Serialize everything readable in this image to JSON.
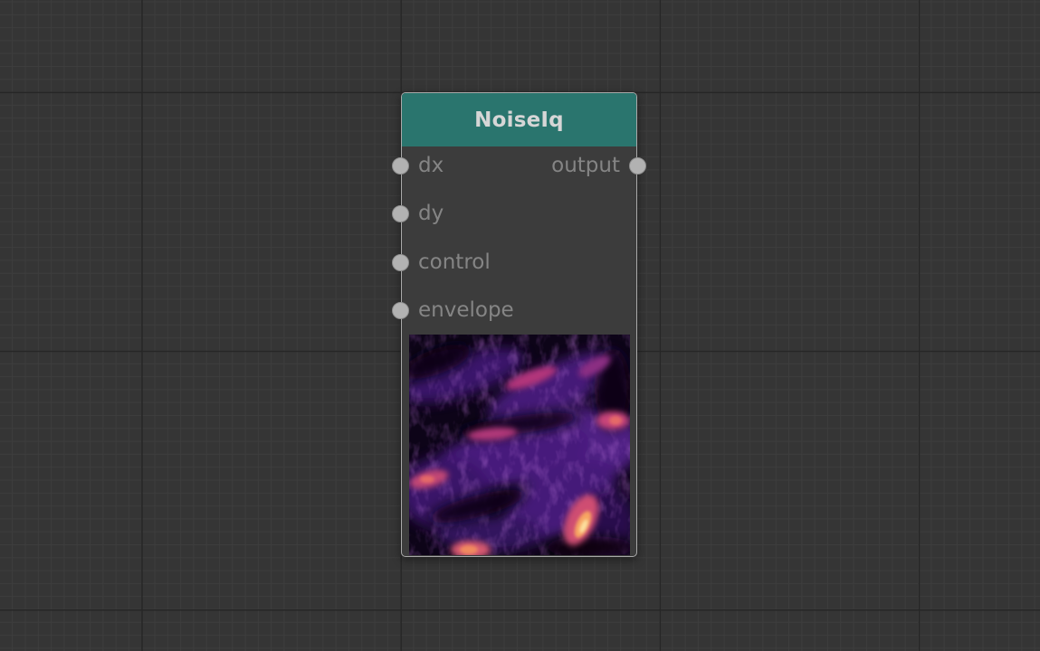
{
  "node": {
    "title": "NoiseIq",
    "header_color": "#2a756e",
    "inputs": [
      {
        "label": "dx"
      },
      {
        "label": "dy"
      },
      {
        "label": "control"
      },
      {
        "label": "envelope"
      }
    ],
    "outputs": [
      {
        "label": "output"
      }
    ],
    "preview": {
      "type": "image",
      "colormap": "magma"
    }
  },
  "canvas": {
    "background": "#353535"
  }
}
